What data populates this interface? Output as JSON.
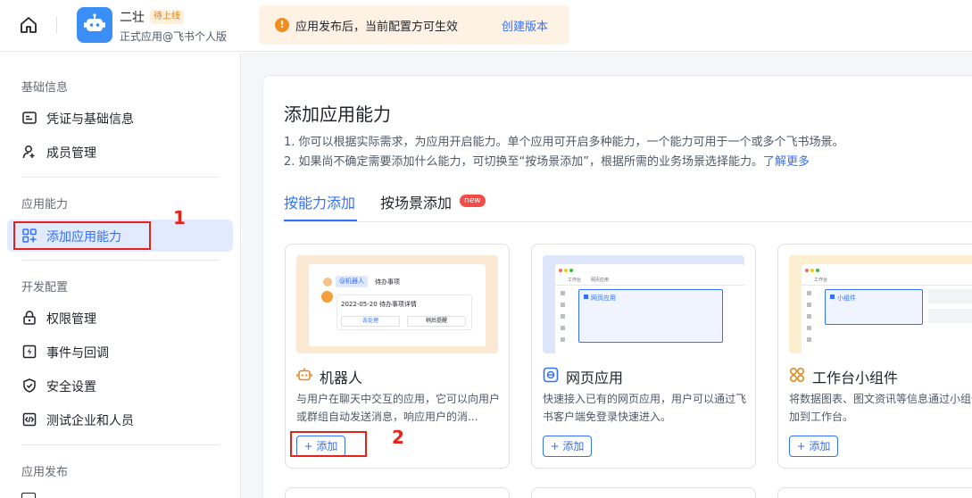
{
  "topbar": {
    "app_name": "二壮",
    "app_badge": "待上线",
    "app_subtitle": "正式应用@飞书个人版",
    "notice_text": "应用发布后，当前配置方可生效",
    "notice_link": "创建版本"
  },
  "sidebar": {
    "groups": {
      "basic": "基础信息",
      "ability": "应用能力",
      "dev": "开发配置",
      "release": "应用发布"
    },
    "items": [
      {
        "label": "凭证与基础信息",
        "icon": "credential-icon"
      },
      {
        "label": "成员管理",
        "icon": "member-add-icon"
      },
      {
        "label": "添加应用能力",
        "icon": "add-ability-icon",
        "active": true
      },
      {
        "label": "权限管理",
        "icon": "lock-icon"
      },
      {
        "label": "事件与回调",
        "icon": "event-icon"
      },
      {
        "label": "安全设置",
        "icon": "shield-icon"
      },
      {
        "label": "测试企业和人员",
        "icon": "code-icon"
      }
    ]
  },
  "main": {
    "title": "添加应用能力",
    "desc_1": "1. 你可以根据实际需求，为应用开启能力。单个应用可开启多种能力，一个能力可用于一个或多个飞书场景。",
    "desc_2": "2. 如果尚不确定需要添加什么能力，可切换至“按场景添加”，根据所需的业务场景选择能力。",
    "desc_link": "了解更多",
    "tabs": [
      {
        "label": "按能力添加",
        "active": true
      },
      {
        "label": "按场景添加",
        "badge": "new"
      }
    ],
    "cards": [
      {
        "title": "机器人",
        "icon": "robot-icon",
        "desc": "与用户在聊天中交互的应用，它可以向用户或群组自动发送消息，响应用户的消...",
        "button": "+ 添加",
        "preview": {
          "tag": "@机器人",
          "line1": "待办事项",
          "line2": "2022-05-20 待办事项详情",
          "btn1": "去处理",
          "btn2": "稍后提醒"
        }
      },
      {
        "title": "网页应用",
        "icon": "web-app-icon",
        "desc": "快速接入已有的网页应用，用户可以通过飞书客户端免登录快速进入。",
        "button": "+ 添加",
        "preview": {
          "tab1": "工作台",
          "tab2": "网页应用",
          "label": "网页应用"
        }
      },
      {
        "title": "工作台小组件",
        "icon": "widget-icon",
        "desc": "将数据图表、图文资讯等信息通过小组件添加到工作台。",
        "button": "+ 添加",
        "preview": {
          "tab1": "工作台",
          "label": "小组件"
        }
      }
    ]
  },
  "annotations": {
    "mark_1": "1",
    "mark_2": "2"
  },
  "colors": {
    "accent": "#3370ff",
    "annotation": "#e6231a",
    "notice_bg": "#fdf2e4",
    "active_bg": "#e1eaff"
  }
}
